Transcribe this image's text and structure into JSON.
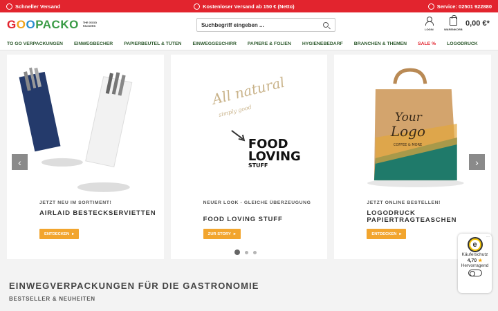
{
  "topbar": {
    "shipping_fast": "Schneller Versand",
    "free_shipping": "Kostenloser Versand ab 150 € (Netto)",
    "service": "Service: 02501 922880"
  },
  "header": {
    "logo_text": "GOOPACKO",
    "logo_tag": "THE GOOD PACKERS",
    "search_placeholder": "Suchbegriff eingeben ...",
    "login_label": "LOGIN",
    "cart_label": "WARENKORB",
    "cart_total": "0,00 €*"
  },
  "nav": {
    "items": [
      {
        "label": "TO GO VERPACKUNGEN"
      },
      {
        "label": "EINWEGBECHER"
      },
      {
        "label": "PAPIERBEUTEL & TÜTEN"
      },
      {
        "label": "EINWEGGESCHIRR"
      },
      {
        "label": "PAPIERE & FOLIEN"
      },
      {
        "label": "HYGIENEBEDARF"
      },
      {
        "label": "BRANCHEN & THEMEN"
      },
      {
        "label": "SALE %"
      },
      {
        "label": "LOGODRUCK"
      }
    ]
  },
  "slides": [
    {
      "subtitle": "JETZT NEU IM SORTIMENT!",
      "title": "AIRLAID BESTECKSERVIETTEN",
      "cta": "ENTDECKEN"
    },
    {
      "subtitle": "NEUER LOOK - GLEICHE ÜBERZEUGUNG",
      "title": "FOOD LOVING STUFF",
      "cta": "ZUR STORY",
      "image_text_1": "All natural",
      "image_text_2": "simply good",
      "image_text_3": "FOOD",
      "image_text_4": "LOVING",
      "image_text_5": "STUFF"
    },
    {
      "subtitle": "JETZT ONLINE BESTELLEN!",
      "title": "LOGODRUCK PAPIERTRAGTEASCHEN",
      "cta": "ENTDECKEN",
      "image_text_1": "Your",
      "image_text_2": "Logo",
      "image_text_3": "COFFEE & MORE"
    }
  ],
  "section": {
    "title": "EINWEGVERPACKUNGEN FÜR DIE GASTRONOMIE",
    "subtitle": "BESTSELLER & NEUHEITEN"
  },
  "trust": {
    "label": "Käuferschutz",
    "rating": "4,70",
    "verdict": "Hervorragend"
  },
  "colors": {
    "brand_red": "#e2242e",
    "cta_orange": "#f2a52e",
    "nav_green": "#2e5a2e"
  }
}
